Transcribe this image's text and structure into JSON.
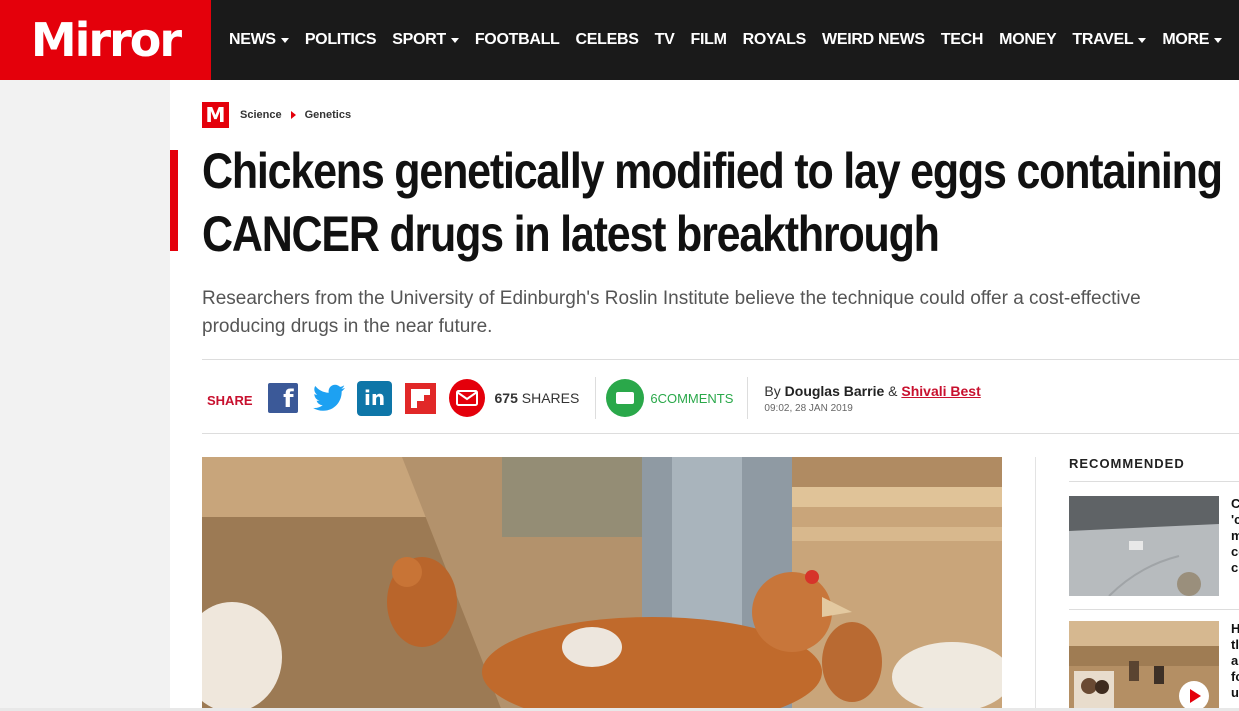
{
  "brand": {
    "logo_text": "Mirror",
    "accent": "#e4000b"
  },
  "nav": {
    "items": [
      {
        "label": "NEWS",
        "dropdown": true
      },
      {
        "label": "POLITICS",
        "dropdown": false
      },
      {
        "label": "SPORT",
        "dropdown": true
      },
      {
        "label": "FOOTBALL",
        "dropdown": false
      },
      {
        "label": "CELEBS",
        "dropdown": false
      },
      {
        "label": "TV",
        "dropdown": false
      },
      {
        "label": "FILM",
        "dropdown": false
      },
      {
        "label": "ROYALS",
        "dropdown": false
      },
      {
        "label": "WEIRD NEWS",
        "dropdown": false
      },
      {
        "label": "TECH",
        "dropdown": false
      },
      {
        "label": "MONEY",
        "dropdown": false
      },
      {
        "label": "TRAVEL",
        "dropdown": true
      },
      {
        "label": "MORE",
        "dropdown": true
      }
    ]
  },
  "breadcrumb": {
    "badge": "M",
    "items": [
      "Science",
      "Genetics"
    ]
  },
  "article": {
    "headline_line1": "Chickens genetically modified to lay eggs containing",
    "headline_line2": "CANCER drugs in latest breakthrough",
    "standfirst_line1": "Researchers from the University of Edinburgh's Roslin Institute believe the technique could offer a cost-effective",
    "standfirst_line2": "producing drugs in the near future."
  },
  "share": {
    "label": "SHARE",
    "count": "675",
    "count_suffix": "SHARES",
    "icons": [
      "facebook-icon",
      "twitter-icon",
      "linkedin-icon",
      "flipboard-icon",
      "email-icon"
    ]
  },
  "comments": {
    "count": "6",
    "label": "COMMENTS"
  },
  "byline": {
    "prefix": "By",
    "author1": "Douglas Barrie",
    "amp": "&",
    "author2": "Shivali Best",
    "timestamp": "09:02, 28 JAN 2019"
  },
  "recommended": {
    "title": "RECOMMENDED",
    "items": [
      {
        "text": "C 'c m cc cl"
      },
      {
        "text": "H tl a fc u"
      }
    ]
  }
}
